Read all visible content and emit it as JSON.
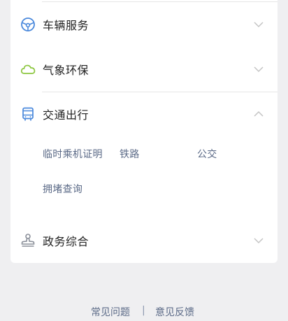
{
  "sections": [
    {
      "icon": "steering-wheel-icon",
      "label": "车辆服务",
      "expanded": false
    },
    {
      "icon": "cloud-icon",
      "label": "气象环保",
      "expanded": false
    },
    {
      "icon": "bus-icon",
      "label": "交通出行",
      "expanded": true,
      "items": [
        "临时乘机证明",
        "铁路",
        "公交",
        "拥堵查询"
      ]
    },
    {
      "icon": "stamp-icon",
      "label": "政务综合",
      "expanded": false
    }
  ],
  "footer": {
    "faq": "常见问题",
    "separator": "|",
    "feedback": "意见反馈"
  },
  "colors": {
    "icon_blue": "#4a89dc",
    "icon_green": "#8cc63f",
    "icon_gray": "#8a8f99",
    "link": "#5b6a87"
  }
}
